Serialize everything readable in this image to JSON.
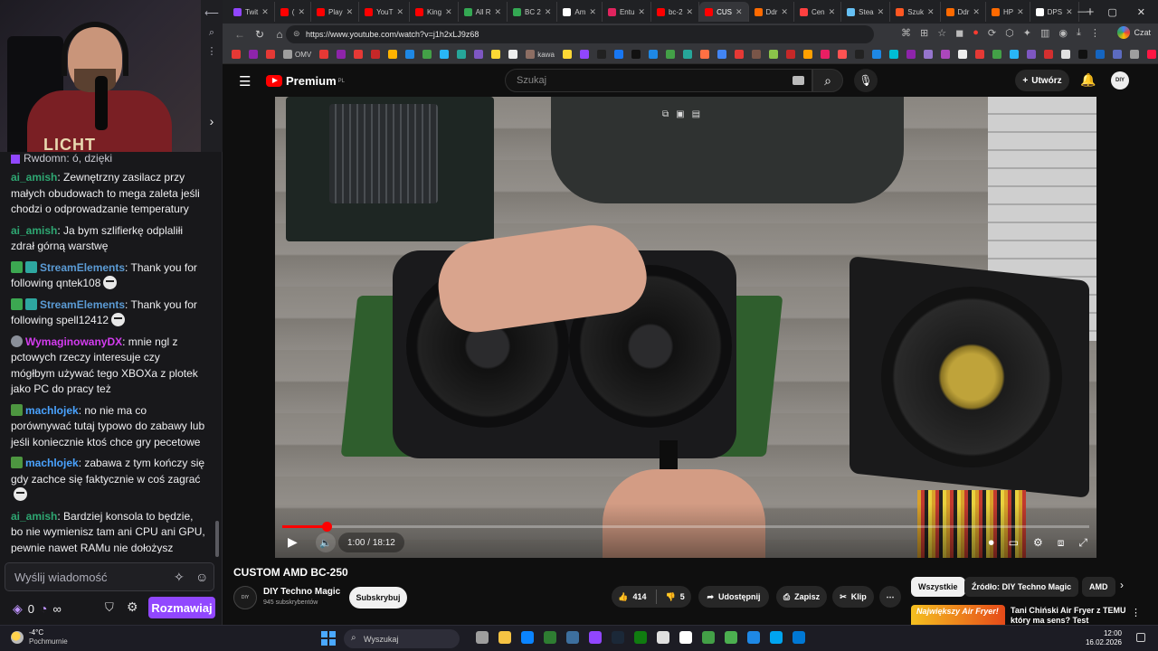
{
  "chat": {
    "pinned_text": "Rwdomn: ó, dzięki",
    "shirt_text": "LICHT",
    "messages": [
      {
        "user": "ai_amish",
        "color": "#2ea772",
        "text": ": Zewnętrzny zasilacz przy małych obudowach to mega zaleta jeśli chodzi o odprowadzanie temperatury",
        "badges": []
      },
      {
        "user": "ai_amish",
        "color": "#2ea772",
        "text": ": Ja bym szlifierkę odplaliłi zdrał górną warstwę",
        "badges": []
      },
      {
        "user": "StreamElements",
        "color": "#5b9bd5",
        "text": ": Thank you for following qntek108",
        "badges": [
          "green",
          "teal"
        ],
        "emote": true
      },
      {
        "user": "StreamElements",
        "color": "#5b9bd5",
        "text": ": Thank you for following spell12412",
        "badges": [
          "green",
          "teal"
        ],
        "emote": true
      },
      {
        "user": "WymaginowanyDX",
        "color": "#d43cf0",
        "text": ": mnie ngl z pctowych rzeczy interesuje czy mógłbym używać tego XBOXa z plotek jako PC do pracy też",
        "badges": [
          "gray"
        ]
      },
      {
        "user": "machlojek",
        "color": "#4aa3ff",
        "text": ": no nie ma co porównywać tutaj typowo do zabawy lub jeśli koniecznie ktoś chce gry pecetowe",
        "badges": [
          "bot"
        ]
      },
      {
        "user": "machlojek",
        "color": "#4aa3ff",
        "text": ": zabawa z tym kończy się gdy zachce się faktycznie w coś zagrać",
        "badges": [
          "bot"
        ],
        "emote": true
      },
      {
        "user": "ai_amish",
        "color": "#2ea772",
        "text": ": Bardziej konsola to będzie, bo nie wymienisz tam ani CPU ani GPU, pewnie nawet RAMu nie dołożysz",
        "badges": []
      }
    ],
    "input_placeholder": "Wyślij wiadomość",
    "points": "0",
    "infinity": "∞",
    "send_label": "Rozmawiaj"
  },
  "browser": {
    "tabs": [
      {
        "label": "Twit",
        "color": "#9146ff",
        "active": false
      },
      {
        "label": "(",
        "color": "#ff0000",
        "active": false
      },
      {
        "label": "Play",
        "color": "#ff0000",
        "active": false
      },
      {
        "label": "YouT",
        "color": "#ff0000",
        "active": false
      },
      {
        "label": "King",
        "color": "#ff0000",
        "active": false
      },
      {
        "label": "All R",
        "color": "#34a853",
        "active": false
      },
      {
        "label": "BC 2",
        "color": "#34a853",
        "active": false
      },
      {
        "label": "Am",
        "color": "#ffffff",
        "active": false
      },
      {
        "label": "Entu",
        "color": "#e0245e",
        "active": false
      },
      {
        "label": "bc-2",
        "color": "#ff0000",
        "active": false
      },
      {
        "label": "CUS",
        "color": "#ff0000",
        "active": true
      },
      {
        "label": "Ddr",
        "color": "#ff6a00",
        "active": false
      },
      {
        "label": "Cen",
        "color": "#ff4040",
        "active": false
      },
      {
        "label": "Stea",
        "color": "#66c0f4",
        "active": false
      },
      {
        "label": "Szuk",
        "color": "#ff5722",
        "active": false
      },
      {
        "label": "Ddr",
        "color": "#ff6a00",
        "active": false
      },
      {
        "label": "HP",
        "color": "#ff6a00",
        "active": false
      },
      {
        "label": "DPS",
        "color": "#ffffff",
        "active": false
      }
    ],
    "url": "https://www.youtube.com/watch?v=j1h2xLJ9z68",
    "chat_label": "Czat",
    "bookmark_labels": {
      "omv": "OMV",
      "kawa": "kawa"
    }
  },
  "youtube": {
    "logo_text": "Premium",
    "logo_region": "PL",
    "search_placeholder": "Szukaj",
    "create_label": "Utwórz",
    "avatar_text": "DIY",
    "video": {
      "time_current": "1:00",
      "time_total": "18:12",
      "progress": 0.055
    },
    "title": "CUSTOM AMD BC-250",
    "channel": "DIY Techno Magic",
    "channel_avatar_text": "DIY",
    "subscribers": "945 subskrybentów",
    "subscribe_label": "Subskrybuj",
    "likes": "414",
    "dislikes": "5",
    "share_label": "Udostępnij",
    "save_label": "Zapisz",
    "clip_label": "Klip",
    "chips": [
      "Wszystkie",
      "Źródło: DIY Techno Magic",
      "AMD"
    ],
    "rec_thumb_text": "Największy Air Fryer!",
    "rec_title": "Tani Chiński Air Fryer z TEMU który ma sens? Test"
  },
  "taskbar": {
    "temp": "-4°C",
    "weather": "Pochmurnie",
    "search_placeholder": "Wyszukaj",
    "time": "12:00",
    "date": "16.02.2026"
  }
}
